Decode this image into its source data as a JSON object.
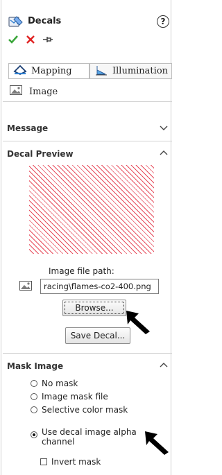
{
  "header": {
    "title": "Decals",
    "help_symbol": "?",
    "icon": "decal-icon"
  },
  "actions": {
    "ok": "ok-check-icon",
    "cancel": "cancel-x-icon",
    "pin": "pin-icon",
    "ok_color": "#3aa63a",
    "cancel_color": "#e02020"
  },
  "tabs": [
    {
      "label": "Mapping",
      "icon": "mapping-icon"
    },
    {
      "label": "Illumination",
      "icon": "illumination-icon"
    }
  ],
  "image_row": {
    "label": "Image",
    "icon": "image-icon"
  },
  "sections": {
    "message": {
      "label": "Message",
      "state": "collapsed"
    },
    "decal_preview": {
      "label": "Decal Preview",
      "state": "expanded",
      "image_file_path_label": "Image file path:",
      "image_file_path": "racing\\flames-co2-400.png",
      "browse_label": "Browse...",
      "save_decal_label": "Save Decal..."
    },
    "mask_image": {
      "label": "Mask Image",
      "state": "expanded",
      "options": [
        "No mask",
        "Image mask file",
        "Selective color mask",
        "Use decal image alpha channel"
      ],
      "selected": "Use decal image alpha channel",
      "invert_mask_label": "Invert mask",
      "invert_mask_checked": false
    }
  },
  "colors": {
    "preview_stripe": "#e74c5c",
    "arrow": "#000000"
  }
}
